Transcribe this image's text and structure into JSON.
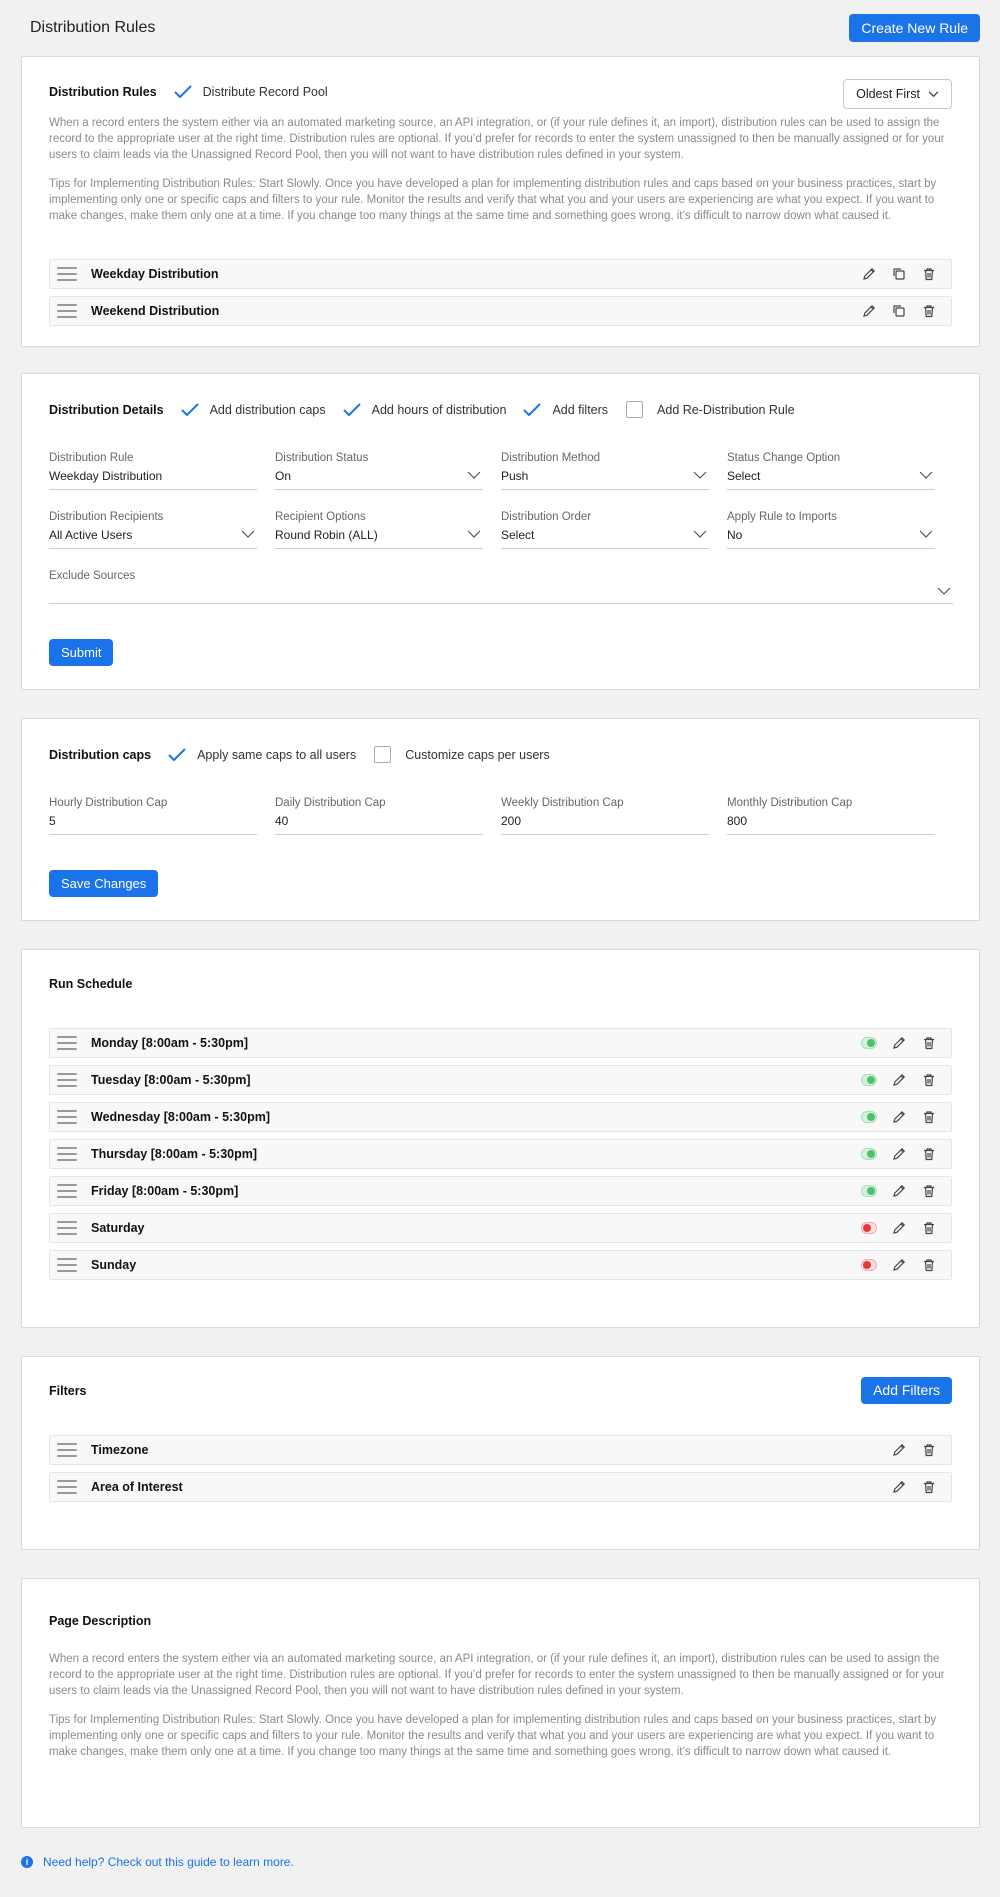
{
  "header": {
    "title": "Distribution Rules",
    "create_button": "Create New Rule"
  },
  "rules_card": {
    "title": "Distribution Rules",
    "option_label": "Distribute Record Pool",
    "sort_select": "Oldest First",
    "desc1": "When a record enters the system either via an automated marketing source, an API integration, or (if your rule defines it, an import), distribution rules can be used to assign the record to the appropriate user at the right time. Distribution rules are optional. If you’d prefer for records to enter the system unassigned to then be manually assigned or for your users to claim leads via the Unassigned Record Pool, then you will not want to have distribution rules defined in your system.",
    "desc2": "Tips for Implementing Distribution Rules: Start Slowly. Once you have developed a plan for implementing distribution rules and caps based on your business practices, start by implementing only one or specific caps and filters to your rule. Monitor the results and verify that what you and your users are experiencing are what you expect. If you want to make changes, make them only one at a time. If you change too many things at the same time and something goes wrong, it’s difficult to narrow down what caused it.",
    "items": [
      "Weekday Distribution",
      "Weekend Distribution"
    ]
  },
  "details_card": {
    "title": "Distribution Details",
    "options": [
      {
        "label": "Add distribution caps",
        "checked": true
      },
      {
        "label": "Add hours of distribution",
        "checked": true
      },
      {
        "label": "Add filters",
        "checked": true
      },
      {
        "label": "Add Re-Distribution Rule",
        "checked": false
      }
    ],
    "fields": [
      {
        "label": "Distribution Rule",
        "value": "Weekday Distribution"
      },
      {
        "label": "Distribution Status",
        "value": "On"
      },
      {
        "label": "Distribution Method",
        "value": "Push"
      },
      {
        "label": "Status Change Option",
        "value": "Select"
      },
      {
        "label": "Distribution Recipients",
        "value": "All Active Users"
      },
      {
        "label": "Recipient Options",
        "value": "Round Robin (ALL)"
      },
      {
        "label": "Distribution Order",
        "value": "Select"
      },
      {
        "label": "Apply Rule to Imports",
        "value": "No"
      }
    ],
    "exclude_label": "Exclude Sources",
    "submit": "Submit"
  },
  "caps_card": {
    "title": "Distribution caps",
    "options": [
      {
        "label": "Apply same caps to all users",
        "checked": true
      },
      {
        "label": "Customize caps per users",
        "checked": false
      }
    ],
    "fields": [
      {
        "label": "Hourly Distribution Cap",
        "value": "5"
      },
      {
        "label": "Daily Distribution Cap",
        "value": "40"
      },
      {
        "label": "Weekly Distribution Cap",
        "value": "200"
      },
      {
        "label": "Monthly Distribution Cap",
        "value": "800"
      }
    ],
    "save": "Save Changes"
  },
  "schedule_card": {
    "title": "Run Schedule",
    "items": [
      {
        "label": "Monday [8:00am - 5:30pm]",
        "enabled": true
      },
      {
        "label": "Tuesday [8:00am - 5:30pm]",
        "enabled": true
      },
      {
        "label": "Wednesday [8:00am - 5:30pm]",
        "enabled": true
      },
      {
        "label": "Thursday [8:00am - 5:30pm]",
        "enabled": true
      },
      {
        "label": "Friday [8:00am - 5:30pm]",
        "enabled": true
      },
      {
        "label": "Saturday",
        "enabled": false
      },
      {
        "label": "Sunday",
        "enabled": false
      }
    ]
  },
  "filters_card": {
    "title": "Filters",
    "add_button": "Add Filters",
    "items": [
      "Timezone",
      "Area of Interest"
    ]
  },
  "description_card": {
    "title": "Page Description",
    "desc1": "When a record enters the system either via an automated marketing source, an API integration, or (if your rule defines it, an import), distribution rules can be used to assign the record to the appropriate user at the right time. Distribution rules are optional. If you’d prefer for records to enter the system unassigned to then be manually assigned or for your users to claim leads via the Unassigned Record Pool, then you will not want to have distribution rules defined in your system.",
    "desc2": "Tips for Implementing Distribution Rules: Start Slowly. Once you have developed a plan for implementing distribution rules and caps based on your business practices, start by implementing only one or specific caps and filters to your rule. Monitor the results and verify that what you and your users are experiencing are what you expect. If you want to make changes, make them only one at a time. If you change too many things at the same time and something goes wrong, it’s difficult to narrow down what caused it."
  },
  "help": {
    "text": "Need help? Check out this guide to learn more."
  },
  "colors": {
    "accent": "#1a73e8",
    "toggle_on": "#4cc36b",
    "toggle_off": "#e53935"
  }
}
